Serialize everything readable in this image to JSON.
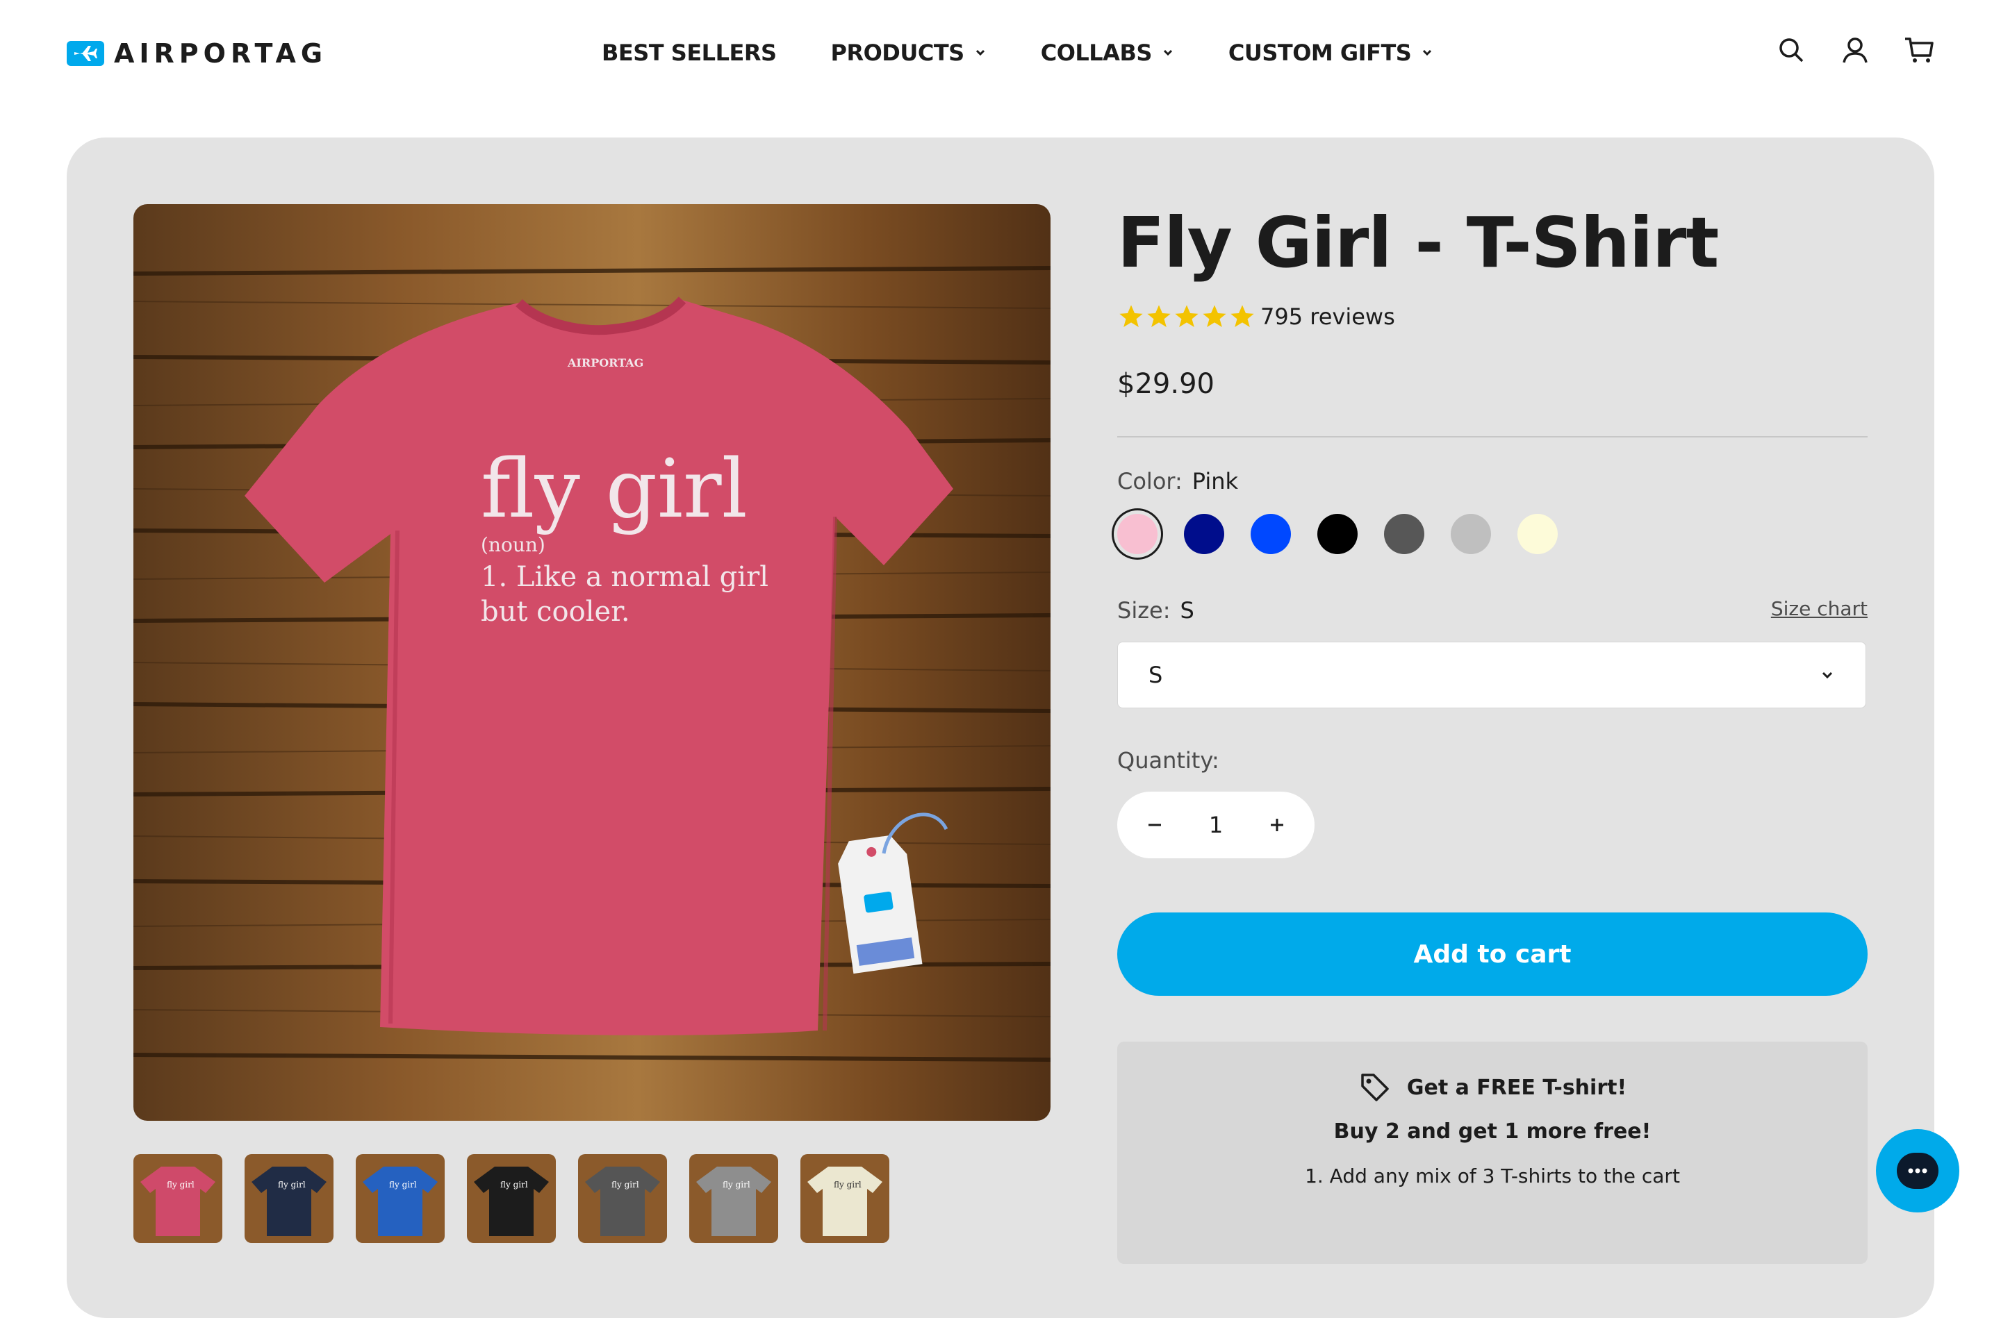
{
  "brand": {
    "name": "AIRPORTAG",
    "logo_icon": "airplane-tag-icon",
    "accent_color": "#00aaea"
  },
  "nav": {
    "items": [
      {
        "label": "BEST SELLERS",
        "has_dropdown": false
      },
      {
        "label": "PRODUCTS",
        "has_dropdown": true
      },
      {
        "label": "COLLABS",
        "has_dropdown": true
      },
      {
        "label": "CUSTOM GIFTS",
        "has_dropdown": true
      }
    ]
  },
  "header_icons": [
    "search-icon",
    "account-icon",
    "cart-icon"
  ],
  "product": {
    "title": "Fly Girl - T-Shirt",
    "rating": 5,
    "reviews": "795 reviews",
    "price": "$29.90",
    "image_print": {
      "brand": "AIRPORTAG",
      "headline": "fly girl",
      "line1": "(noun)",
      "line2": "1. Like a normal girl",
      "line3": "but cooler."
    },
    "color": {
      "label": "Color:",
      "value": "Pink",
      "swatches": [
        {
          "name": "Pink",
          "hex": "#f8bfd1",
          "selected": true
        },
        {
          "name": "Navy",
          "hex": "#000d8c"
        },
        {
          "name": "Blue",
          "hex": "#0048ff"
        },
        {
          "name": "Black",
          "hex": "#000000"
        },
        {
          "name": "Charcoal",
          "hex": "#575757"
        },
        {
          "name": "Gray",
          "hex": "#bfbfbf"
        },
        {
          "name": "Cream",
          "hex": "#fdfbd9"
        }
      ]
    },
    "size": {
      "label": "Size:",
      "value": "S",
      "chart_link": "Size chart",
      "selected_option": "S"
    },
    "quantity": {
      "label": "Quantity:",
      "value": "1"
    },
    "add_to_cart": "Add to cart",
    "thumbnails": [
      {
        "color": "#cf4a6a",
        "selected": true
      },
      {
        "color": "#202c45"
      },
      {
        "color": "#2561c0"
      },
      {
        "color": "#1c1c1c"
      },
      {
        "color": "#555555"
      },
      {
        "color": "#8e8e8e"
      },
      {
        "color": "#ebe7d0"
      }
    ]
  },
  "promo": {
    "headline": "Get a FREE T-shirt!",
    "sub": "Buy 2 and get 1 more free!",
    "step1": "1. Add any mix of 3 T-shirts to the cart"
  }
}
